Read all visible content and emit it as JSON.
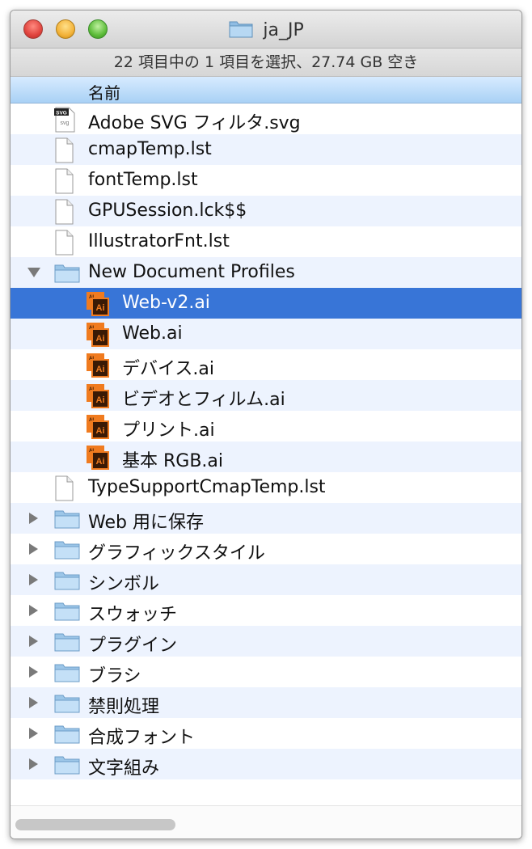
{
  "window": {
    "title": "ja_JP",
    "status": "22 項目中の 1 項目を選択、27.74 GB 空き",
    "column_header": "名前"
  },
  "items": [
    {
      "label": "Adobe SVG フィルタ.svg",
      "icon": "svg-file-icon",
      "level": 0
    },
    {
      "label": "cmapTemp.lst",
      "icon": "document-icon",
      "level": 0
    },
    {
      "label": "fontTemp.lst",
      "icon": "document-icon",
      "level": 0
    },
    {
      "label": "GPUSession.lck$$",
      "icon": "document-icon",
      "level": 0
    },
    {
      "label": "IllustratorFnt.lst",
      "icon": "document-icon",
      "level": 0
    },
    {
      "label": "New Document Profiles",
      "icon": "folder-icon",
      "level": 0,
      "expanded": true
    },
    {
      "label": "Web-v2.ai",
      "icon": "illustrator-file-icon",
      "level": 1,
      "selected": true
    },
    {
      "label": "Web.ai",
      "icon": "illustrator-file-icon",
      "level": 1
    },
    {
      "label": "デバイス.ai",
      "icon": "illustrator-file-icon",
      "level": 1
    },
    {
      "label": "ビデオとフィルム.ai",
      "icon": "illustrator-file-icon",
      "level": 1
    },
    {
      "label": "プリント.ai",
      "icon": "illustrator-file-icon",
      "level": 1
    },
    {
      "label": "基本 RGB.ai",
      "icon": "illustrator-file-icon",
      "level": 1
    },
    {
      "label": "TypeSupportCmapTemp.lst",
      "icon": "document-icon",
      "level": 0
    },
    {
      "label": "Web 用に保存",
      "icon": "folder-icon",
      "level": 0,
      "expanded": false
    },
    {
      "label": "グラフィックスタイル",
      "icon": "folder-icon",
      "level": 0,
      "expanded": false
    },
    {
      "label": "シンボル",
      "icon": "folder-icon",
      "level": 0,
      "expanded": false
    },
    {
      "label": "スウォッチ",
      "icon": "folder-icon",
      "level": 0,
      "expanded": false
    },
    {
      "label": "プラグイン",
      "icon": "folder-icon",
      "level": 0,
      "expanded": false
    },
    {
      "label": "ブラシ",
      "icon": "folder-icon",
      "level": 0,
      "expanded": false
    },
    {
      "label": "禁則処理",
      "icon": "folder-icon",
      "level": 0,
      "expanded": false
    },
    {
      "label": "合成フォント",
      "icon": "folder-icon",
      "level": 0,
      "expanded": false
    },
    {
      "label": "文字組み",
      "icon": "folder-icon",
      "level": 0,
      "expanded": false
    }
  ],
  "colors": {
    "selection": "#3875d7",
    "alternate_row": "#edf3fe",
    "header_blue": "#a9d1f5",
    "ai_icon_orange": "#f07b1f",
    "ai_icon_dark": "#3a1a05",
    "folder_blue": "#9cc6e8"
  }
}
